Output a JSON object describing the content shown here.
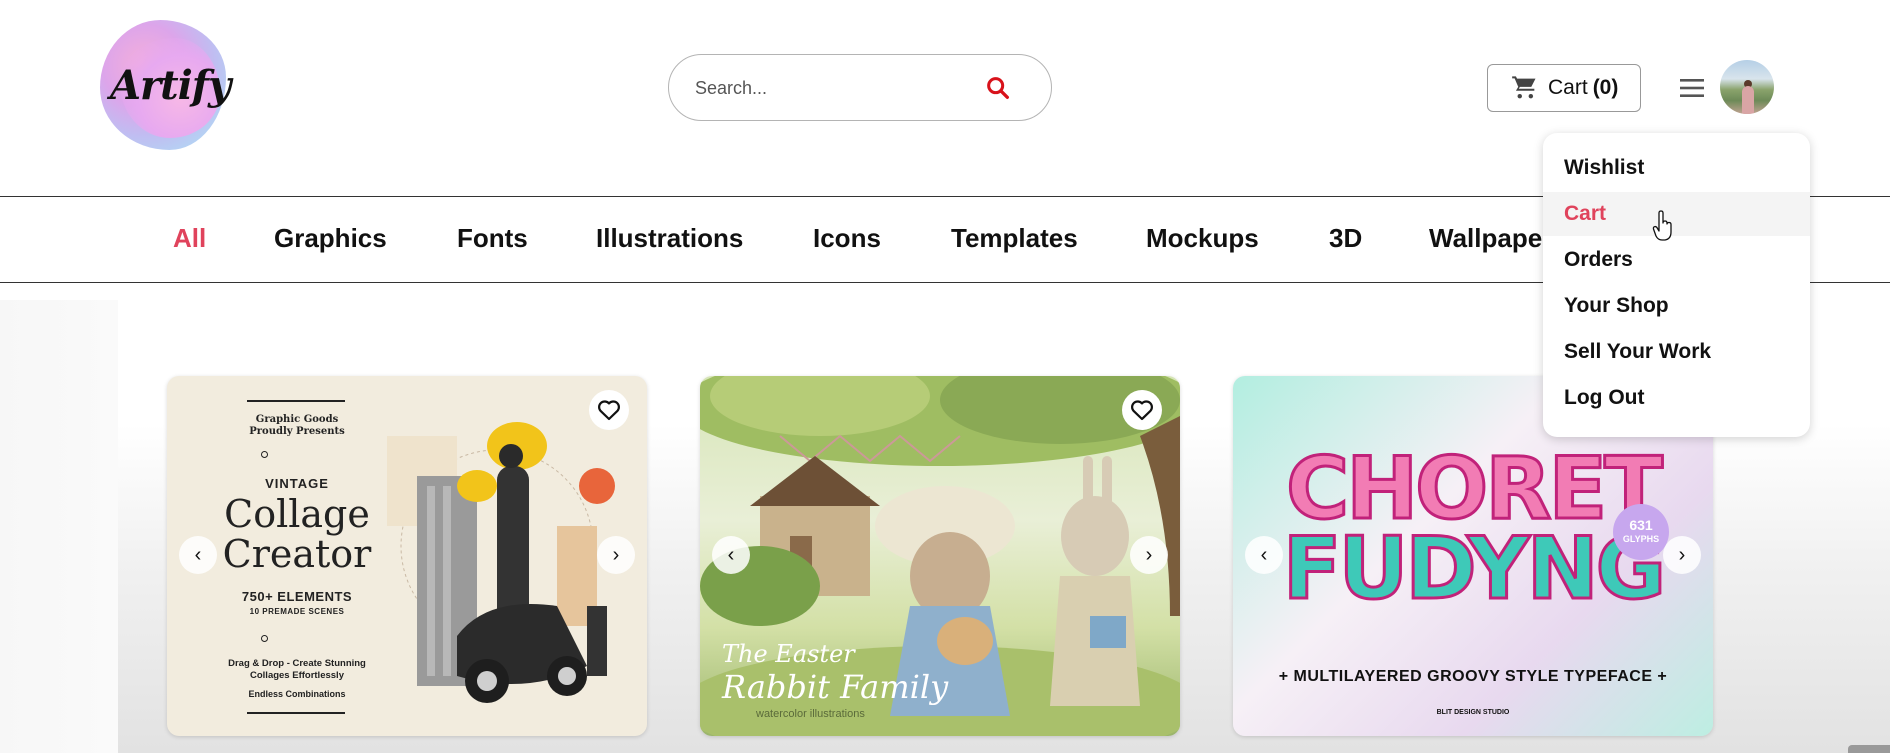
{
  "brand": {
    "logo_text": "Artify"
  },
  "search": {
    "placeholder": "Search..."
  },
  "header": {
    "cart_label": "Cart",
    "cart_count": "(0)"
  },
  "categories": [
    "All",
    "Graphics",
    "Fonts",
    "Illustrations",
    "Icons",
    "Templates",
    "Mockups",
    "3D",
    "Wallpape"
  ],
  "active_category": "All",
  "dropdown": {
    "items": [
      "Wishlist",
      "Cart",
      "Orders",
      "Your Shop",
      "Sell Your Work",
      "Log Out"
    ],
    "hovered": "Cart"
  },
  "cards": [
    {
      "presenter": "Graphic Goods",
      "presents": "Proudly Presents",
      "kicker": "VINTAGE",
      "title_line1": "Collage",
      "title_line2": "Creator",
      "elements": "750+ ELEMENTS",
      "scenes": "10 PREMADE SCENES",
      "desc_line1": "Drag & Drop - Create Stunning",
      "desc_line2": "Collages Effortlessly",
      "endless": "Endless Combinations"
    },
    {
      "caption_line1": "The Easter",
      "caption_line2": "Rabbit Family",
      "caption_line3": "watercolor illustrations"
    },
    {
      "word1": "CHORET",
      "word2": "FUDYNG",
      "badge_line1": "631",
      "badge_line2": "GLYPHS",
      "tagline": "+ MULTILAYERED GROOVY STYLE TYPEFACE +",
      "studio": "BLIT DESIGN STUDIO"
    }
  ],
  "colors": {
    "accent": "#e0435c",
    "search_icon": "#d8121b"
  }
}
